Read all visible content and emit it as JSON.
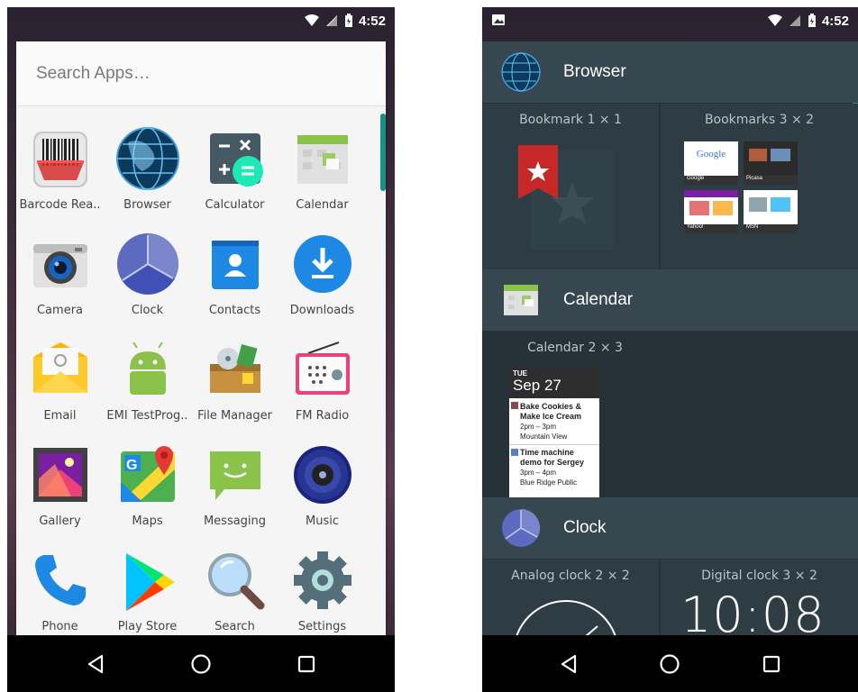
{
  "left": {
    "status": {
      "time": "4:52"
    },
    "search": {
      "placeholder": "Search Apps…"
    },
    "apps": [
      {
        "label": "Barcode Rea..",
        "icon": "barcode-reader-icon"
      },
      {
        "label": "Browser",
        "icon": "browser-globe-icon"
      },
      {
        "label": "Calculator",
        "icon": "calculator-icon"
      },
      {
        "label": "Calendar",
        "icon": "calendar-icon"
      },
      {
        "label": "Camera",
        "icon": "camera-icon"
      },
      {
        "label": "Clock",
        "icon": "clock-icon"
      },
      {
        "label": "Contacts",
        "icon": "contacts-icon"
      },
      {
        "label": "Downloads",
        "icon": "downloads-icon"
      },
      {
        "label": "Email",
        "icon": "email-icon"
      },
      {
        "label": "EMI TestProg..",
        "icon": "android-icon"
      },
      {
        "label": "File Manager",
        "icon": "file-manager-icon"
      },
      {
        "label": "FM Radio",
        "icon": "radio-icon"
      },
      {
        "label": "Gallery",
        "icon": "gallery-icon"
      },
      {
        "label": "Maps",
        "icon": "maps-icon"
      },
      {
        "label": "Messaging",
        "icon": "messaging-icon"
      },
      {
        "label": "Music",
        "icon": "music-icon"
      },
      {
        "label": "Phone",
        "icon": "phone-icon"
      },
      {
        "label": "Play Store",
        "icon": "play-store-icon"
      },
      {
        "label": "Search",
        "icon": "search-icon"
      },
      {
        "label": "Settings",
        "icon": "settings-icon"
      }
    ]
  },
  "right": {
    "status": {
      "time": "4:52"
    },
    "sections": {
      "browser": {
        "title": "Browser",
        "widgets": {
          "bookmark": "Bookmark  1 × 1",
          "bookmarks": "Bookmarks  3 × 2"
        },
        "thumbs": [
          "Google",
          "Picasa",
          "Yahoo!",
          "MSN"
        ]
      },
      "calendar": {
        "title": "Calendar",
        "widget": "Calendar  2 × 3",
        "preview": {
          "day": "TUE",
          "date": "Sep 27",
          "events": [
            {
              "title1": "Bake Cookies &",
              "title2": "Make Ice Cream",
              "time": "2pm – 3pm",
              "place": "Mountain View"
            },
            {
              "title1": "Time machine",
              "title2": "demo for Sergey",
              "time": "3pm – 4pm",
              "place": "Blue Ridge Public"
            }
          ]
        }
      },
      "clock": {
        "title": "Clock",
        "widgets": {
          "analog": "Analog clock  2 × 2",
          "digital": "Digital clock  3 × 2"
        },
        "digital_time": "10:08"
      }
    }
  },
  "colors": {
    "accent": "#1a8f86",
    "drawer_bg": "#f5f5f5",
    "widget_bg": "#263238",
    "header_bg": "#37474f"
  }
}
